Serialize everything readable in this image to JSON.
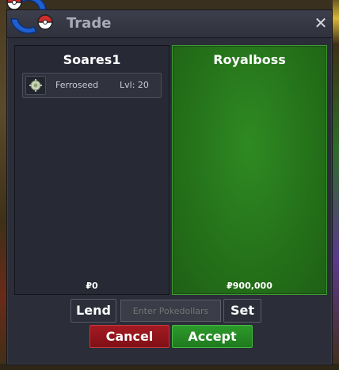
{
  "window": {
    "title": "Trade",
    "close_label": "✕"
  },
  "left_panel": {
    "player": "Soares1",
    "money": "₽0",
    "items": [
      {
        "name": "Ferroseed",
        "level": "Lvl: 20"
      }
    ]
  },
  "right_panel": {
    "player": "Royalboss",
    "money": "₽900,000"
  },
  "controls": {
    "lend_label": "Lend",
    "pokedollars_placeholder": "Enter Pokedollars",
    "set_label": "Set",
    "cancel_label": "Cancel",
    "accept_label": "Accept"
  },
  "colors": {
    "accept_panel": "#247019",
    "cancel": "#a41a22",
    "accept": "#2c9a2a"
  },
  "icons": [
    "trade-logo-icon",
    "close-icon",
    "ferroseed-icon"
  ]
}
